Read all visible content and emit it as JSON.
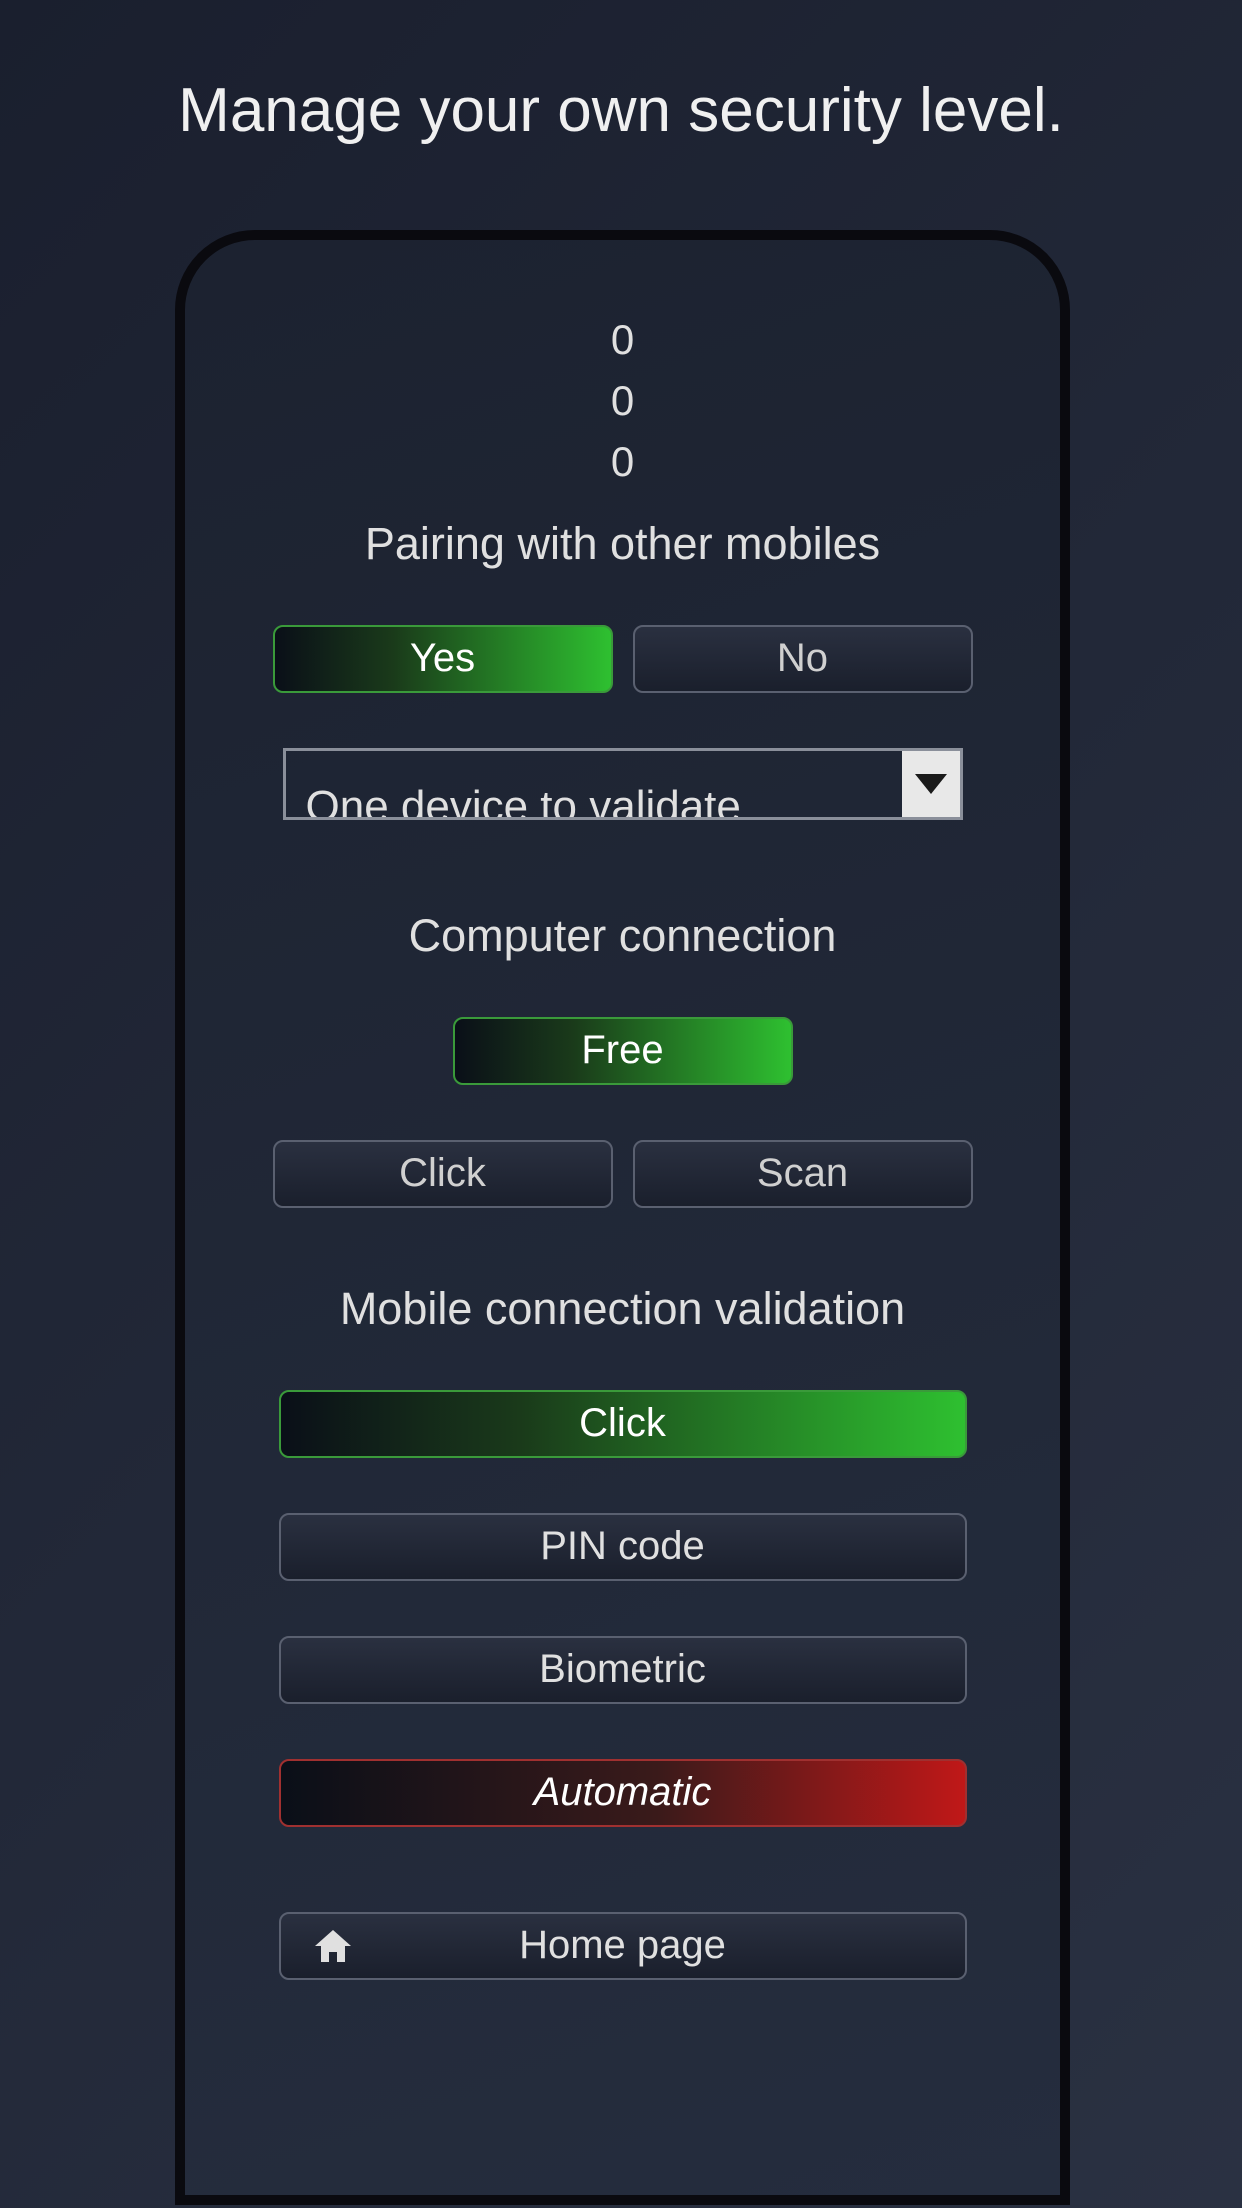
{
  "title": "Manage your own security level.",
  "counters": {
    "c1": "0",
    "c2": "0",
    "c3": "0"
  },
  "sections": {
    "pairing": {
      "label": "Pairing with other mobiles",
      "yes": "Yes",
      "no": "No"
    },
    "dropdown": {
      "selected": "One device to validate"
    },
    "computer": {
      "label": "Computer connection",
      "free": "Free",
      "click": "Click",
      "scan": "Scan"
    },
    "mobile": {
      "label": "Mobile connection validation",
      "click": "Click",
      "pin": "PIN code",
      "biometric": "Biometric",
      "automatic": "Automatic"
    },
    "home": "Home page"
  }
}
